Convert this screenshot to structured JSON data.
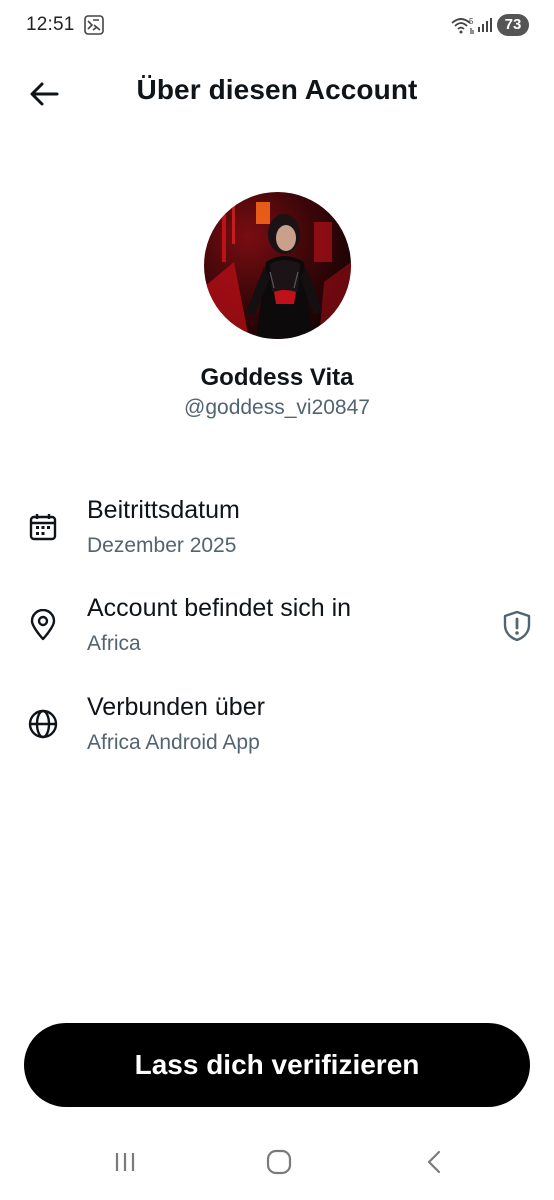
{
  "status_bar": {
    "time": "12:51",
    "battery": "73",
    "icons": [
      "notification-icon",
      "wifi-icon",
      "signal-icon",
      "battery-icon"
    ]
  },
  "header": {
    "title": "Über diesen Account",
    "back_icon": "arrow-left-icon"
  },
  "profile": {
    "display_name": "Goddess Vita",
    "handle": "@goddess_vi20847",
    "avatar": "profile-photo"
  },
  "info_rows": [
    {
      "icon": "calendar-icon",
      "label": "Beitrittsdatum",
      "value": "Dezember 2025"
    },
    {
      "icon": "location-pin-icon",
      "label": "Account befindet sich in",
      "value": "Africa",
      "action_icon": "shield-alert-icon"
    },
    {
      "icon": "globe-icon",
      "label": "Verbunden über",
      "value": "Africa Android App"
    }
  ],
  "cta": {
    "label": "Lass dich verifizieren"
  },
  "nav_bar": {
    "items": [
      "recent-apps-icon",
      "home-icon",
      "back-icon"
    ]
  },
  "colors": {
    "text_primary": "#0f1419",
    "text_secondary": "#536471",
    "button_bg": "#000000",
    "button_text": "#ffffff",
    "background": "#ffffff"
  }
}
